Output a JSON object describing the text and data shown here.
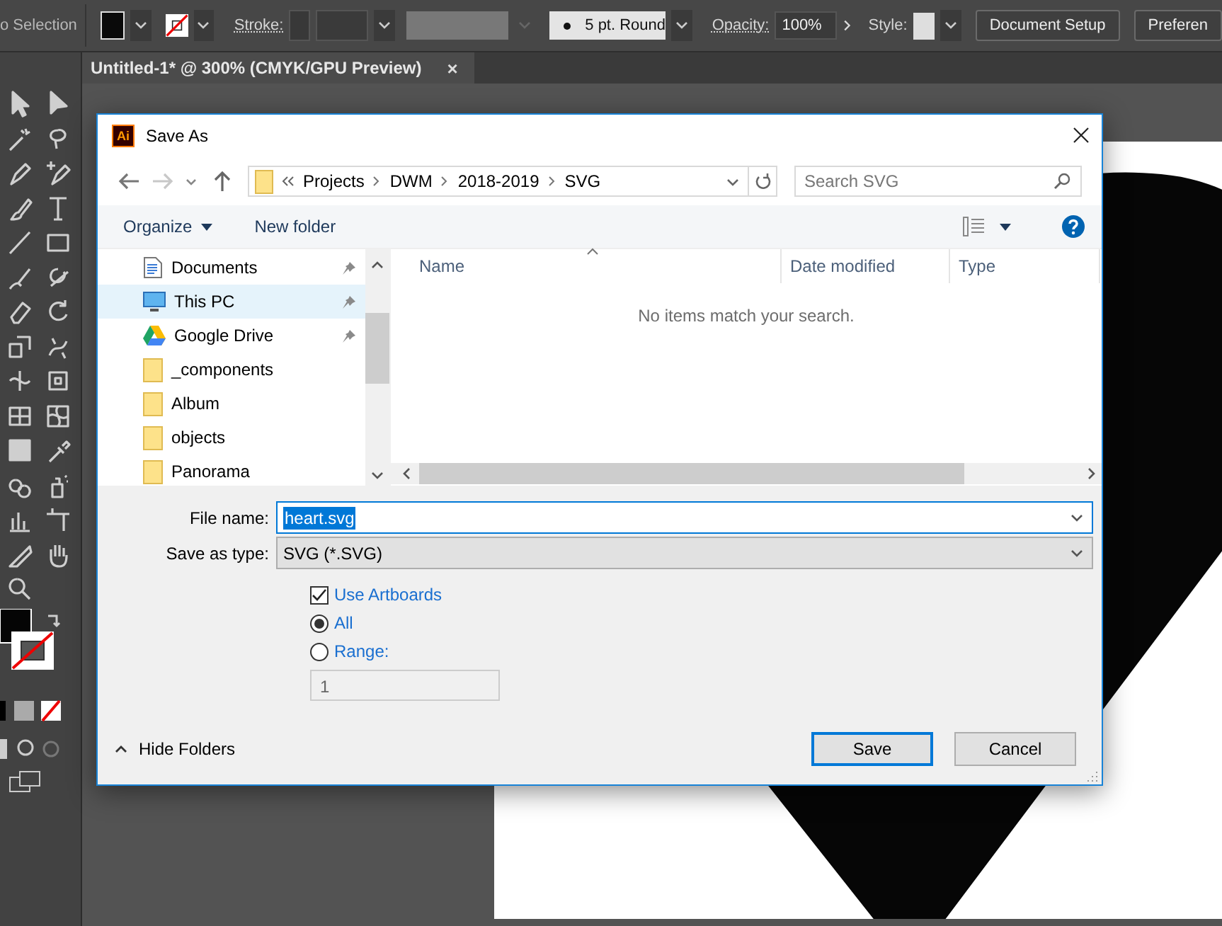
{
  "control_bar": {
    "selection": "o Selection",
    "stroke_label": "Stroke:",
    "brush": "5 pt. Round",
    "opacity_label": "Opacity:",
    "opacity": "100%",
    "style_label": "Style:",
    "buttons": [
      "Document Setup",
      "Preferen"
    ]
  },
  "document_tab": {
    "title": "Untitled-1* @ 300% (CMYK/GPU Preview)",
    "close": "×"
  },
  "dialog": {
    "app_badge": "Ai",
    "title": "Save As",
    "breadcrumb": [
      "Projects",
      "DWM",
      "2018-2019",
      "SVG"
    ],
    "search": {
      "placeholder": "Search SVG"
    },
    "toolbar": [
      "Organize",
      "New folder"
    ],
    "nav_items": [
      {
        "label": "Documents",
        "kind": "documents",
        "pinned": true,
        "selected": false
      },
      {
        "label": "This PC",
        "kind": "computer",
        "pinned": true,
        "selected": true
      },
      {
        "label": "Google Drive",
        "kind": "drive",
        "pinned": true,
        "selected": false
      },
      {
        "label": "_components",
        "kind": "folder",
        "pinned": false,
        "selected": false
      },
      {
        "label": "Album",
        "kind": "folder",
        "pinned": false,
        "selected": false
      },
      {
        "label": "objects",
        "kind": "folder",
        "pinned": false,
        "selected": false
      },
      {
        "label": "Panorama",
        "kind": "folder",
        "pinned": false,
        "selected": false
      }
    ],
    "columns": [
      "Name",
      "Date modified",
      "Type"
    ],
    "empty_message": "No items match your search.",
    "file_name": {
      "label": "File name:",
      "value": "heart.svg"
    },
    "save_as_type": {
      "label": "Save as type:",
      "value": "SVG (*.SVG)"
    },
    "use_artboards": {
      "label": "Use Artboards",
      "checked": true
    },
    "range_options": [
      {
        "label": "All",
        "selected": true
      },
      {
        "label": "Range:",
        "selected": false
      }
    ],
    "range_value": "1",
    "hide_folders": "Hide Folders",
    "buttons": [
      {
        "label": "Save",
        "kind": "primary"
      },
      {
        "label": "Cancel",
        "kind": "secondary"
      }
    ]
  }
}
